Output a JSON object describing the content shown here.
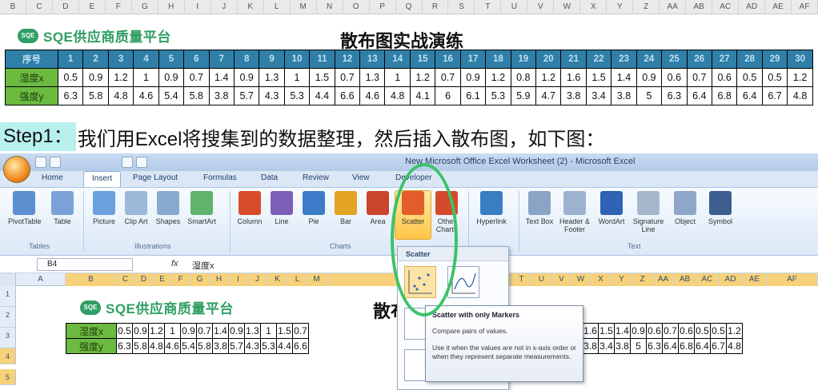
{
  "column_letters": [
    "B",
    "C",
    "D",
    "E",
    "F",
    "G",
    "H",
    "I",
    "J",
    "K",
    "L",
    "M",
    "N",
    "O",
    "P",
    "Q",
    "R",
    "S",
    "T",
    "U",
    "V",
    "W",
    "X",
    "Y",
    "Z",
    "AA",
    "AB",
    "AC",
    "AD",
    "AE",
    "AF"
  ],
  "banner": {
    "logo_badge": "SQE",
    "logo_text": "SQE供应商质量平台",
    "title": "散布图实战演练"
  },
  "table": {
    "header_label": "序号",
    "numbers": [
      "1",
      "2",
      "3",
      "4",
      "5",
      "6",
      "7",
      "8",
      "9",
      "10",
      "11",
      "12",
      "13",
      "14",
      "15",
      "16",
      "17",
      "18",
      "19",
      "20",
      "21",
      "22",
      "23",
      "24",
      "25",
      "26",
      "27",
      "28",
      "29",
      "30"
    ],
    "row_x_label": "湿度x",
    "row_x": [
      "0.5",
      "0.9",
      "1.2",
      "1",
      "0.9",
      "0.7",
      "1.4",
      "0.9",
      "1.3",
      "1",
      "1.5",
      "0.7",
      "1.3",
      "1",
      "1.2",
      "0.7",
      "0.9",
      "1.2",
      "0.8",
      "1.2",
      "1.6",
      "1.5",
      "1.4",
      "0.9",
      "0.6",
      "0.7",
      "0.6",
      "0.5",
      "0.5",
      "1.2"
    ],
    "row_y_label": "强度y",
    "row_y": [
      "6.3",
      "5.8",
      "4.8",
      "4.6",
      "5.4",
      "5.8",
      "3.8",
      "5.7",
      "4.3",
      "5.3",
      "4.4",
      "6.6",
      "4.6",
      "4.8",
      "4.1",
      "6",
      "6.1",
      "5.3",
      "5.9",
      "4.7",
      "3.8",
      "3.4",
      "3.8",
      "5",
      "6.3",
      "6.4",
      "6.8",
      "6.4",
      "6.7",
      "4.8"
    ]
  },
  "step": {
    "tag": "Step1：",
    "text": "我们用Excel将搜集到的数据整理，然后插入散布图，如下图："
  },
  "excel": {
    "window_title": "New Microsoft Office Excel Worksheet (2) - Microsoft Excel",
    "tabs": [
      "Home",
      "Insert",
      "Page Layout",
      "Formulas",
      "Data",
      "Review",
      "View",
      "Developer"
    ],
    "ribbon_buttons": [
      {
        "label": "PivotTable",
        "icon": "pivottable-icon",
        "color": "#5b8fd0"
      },
      {
        "label": "Table",
        "icon": "table-icon",
        "color": "#7aa2d6"
      },
      {
        "label": "Picture",
        "icon": "picture-icon",
        "color": "#6aa0dc"
      },
      {
        "label": "Clip Art",
        "icon": "clipart-icon",
        "color": "#9bb8d9"
      },
      {
        "label": "Shapes",
        "icon": "shapes-icon",
        "color": "#8aa9cf"
      },
      {
        "label": "SmartArt",
        "icon": "smartart-icon",
        "color": "#5fb36a"
      },
      {
        "label": "Column",
        "icon": "column-chart-icon",
        "color": "#d84b2a"
      },
      {
        "label": "Line",
        "icon": "line-chart-icon",
        "color": "#7b5fb8"
      },
      {
        "label": "Pie",
        "icon": "pie-chart-icon",
        "color": "#3d7cc9"
      },
      {
        "label": "Bar",
        "icon": "bar-chart-icon",
        "color": "#e3a324"
      },
      {
        "label": "Area",
        "icon": "area-chart-icon",
        "color": "#c9452b"
      },
      {
        "label": "Scatter",
        "icon": "scatter-chart-icon",
        "color": "#e25d2a"
      },
      {
        "label": "Other Charts",
        "icon": "other-charts-icon",
        "color": "#d44b2b"
      },
      {
        "label": "Hyperlink",
        "icon": "hyperlink-icon",
        "color": "#3a7ec2"
      },
      {
        "label": "Text Box",
        "icon": "textbox-icon",
        "color": "#8aa4c6"
      },
      {
        "label": "Header & Footer",
        "icon": "header-footer-icon",
        "color": "#9cb2cf"
      },
      {
        "label": "WordArt",
        "icon": "wordart-icon",
        "color": "#2e63b5"
      },
      {
        "label": "Signature Line",
        "icon": "signature-icon",
        "color": "#a7b7cb"
      },
      {
        "label": "Object",
        "icon": "object-icon",
        "color": "#8ea7c9"
      },
      {
        "label": "Symbol",
        "icon": "symbol-icon",
        "color": "#3c5f8f"
      }
    ],
    "groups": [
      "Tables",
      "Illustrations",
      "Charts",
      "Text"
    ],
    "name_box": "B4",
    "fx": "fx",
    "formula_value": "湿度x",
    "grid_columns": [
      "A",
      "B",
      "C",
      "D",
      "E",
      "F",
      "G",
      "H",
      "I",
      "J",
      "K",
      "L",
      "M",
      "N",
      "T",
      "U",
      "V",
      "W",
      "X",
      "Y",
      "Z",
      "AA",
      "AB",
      "AC",
      "AD",
      "AE",
      "AF"
    ],
    "row_numbers": [
      "1",
      "2",
      "3",
      "4",
      "5"
    ],
    "sheet_title_fragment": "散布",
    "sheet_left_x": [
      "0.5",
      "0.9",
      "1.2",
      "1",
      "0.9",
      "0.7",
      "1.4",
      "0.9",
      "1.3",
      "1",
      "1.5",
      "0.7"
    ],
    "sheet_left_y": [
      "6.3",
      "5.8",
      "4.8",
      "4.6",
      "5.4",
      "5.8",
      "3.8",
      "5.7",
      "4.3",
      "5.3",
      "4.4",
      "6.6"
    ],
    "sheet_right_x": [
      "1.6",
      "1.5",
      "1.4",
      "0.9",
      "0.6",
      "0.7",
      "0.6",
      "0.5",
      "0.5",
      "1.2"
    ],
    "sheet_right_y": [
      "3.8",
      "3.4",
      "3.8",
      "5",
      "6.3",
      "6.4",
      "6.8",
      "6.4",
      "6.7",
      "4.8"
    ],
    "dropdown_title": "Scatter",
    "tooltip": {
      "title": "Scatter with only Markers",
      "line1": "Compare pairs of values.",
      "line2": "Use it when the values are not in x-axis order or when they represent separate measurements."
    }
  },
  "colors": {
    "header_blue": "#2f7fa8",
    "label_green": "#6cba3f",
    "brand_green": "#2f9e63",
    "highlight_ring": "#3cc26a"
  }
}
